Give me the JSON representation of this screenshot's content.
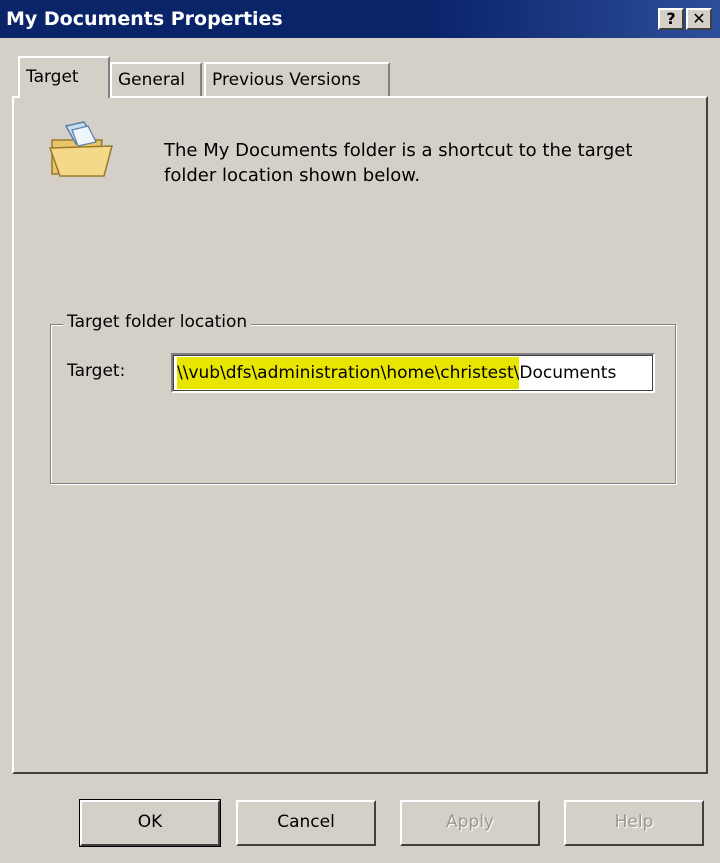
{
  "window": {
    "title": "My Documents Properties",
    "help_glyph": "?",
    "close_glyph": "✕"
  },
  "tabs": [
    {
      "label": "Target",
      "active": true
    },
    {
      "label": "General",
      "active": false
    },
    {
      "label": "Previous Versions",
      "active": false
    }
  ],
  "target_tab": {
    "icon": "folder-open-icon",
    "description": "The My Documents folder is a shortcut to the target folder location shown below.",
    "group_title": "Target folder location",
    "target_label": "Target:",
    "target_value_highlighted": "\\\\vub\\dfs\\administration\\home\\christest\\",
    "target_value_rest": "Documents"
  },
  "buttons": {
    "ok": "OK",
    "cancel": "Cancel",
    "apply": "Apply",
    "help": "Help"
  },
  "colors": {
    "title_bar": "#0a246a",
    "face": "#d4d0c8",
    "highlight": "#e8e600"
  }
}
